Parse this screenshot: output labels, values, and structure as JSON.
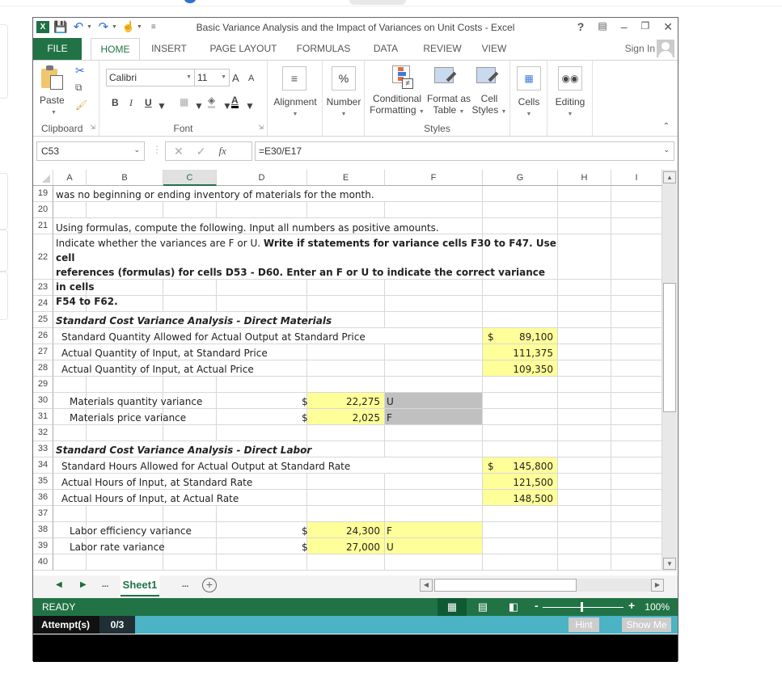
{
  "window": {
    "title": "Basic Variance Analysis and the Impact of Variances on Unit Costs - Excel",
    "controls": {
      "help": "?",
      "ribbon_display": "⊼",
      "minimize": "–",
      "restore": "🗗",
      "close": "✕"
    }
  },
  "quick_access": {
    "icons": [
      "excel-logo-icon",
      "save-icon",
      "undo-icon",
      "redo-icon",
      "touch-mode-icon",
      "customize-qat-icon"
    ]
  },
  "tabs": [
    {
      "label": "FILE",
      "active": false
    },
    {
      "label": "HOME",
      "active": true
    },
    {
      "label": "INSERT",
      "active": false
    },
    {
      "label": "PAGE LAYOUT",
      "active": false
    },
    {
      "label": "FORMULAS",
      "active": false
    },
    {
      "label": "DATA",
      "active": false
    },
    {
      "label": "REVIEW",
      "active": false
    },
    {
      "label": "VIEW",
      "active": false
    }
  ],
  "signin": {
    "label": "Sign In"
  },
  "ribbon": {
    "clipboard": {
      "group_label": "Clipboard",
      "paste_label": "Paste"
    },
    "font": {
      "group_label": "Font",
      "font_name": "Calibri",
      "font_size": "11",
      "bold": "B",
      "italic": "I",
      "underline": "U",
      "grow": "A",
      "shrink": "A",
      "font_color": "A"
    },
    "alignment": {
      "label": "Alignment"
    },
    "number": {
      "label": "Number",
      "symbol": "%"
    },
    "styles": {
      "group_label": "Styles",
      "conditional_line1": "Conditional",
      "conditional_line2": "Formatting",
      "format_table_line1": "Format as",
      "format_table_line2": "Table",
      "cell_styles_line1": "Cell",
      "cell_styles_line2": "Styles"
    },
    "cells": {
      "label": "Cells"
    },
    "editing": {
      "label": "Editing"
    }
  },
  "formula_bar": {
    "name_box": "C53",
    "cancel": "✕",
    "enter": "✓",
    "fx": "fx",
    "formula": "=E30/E17"
  },
  "columns": [
    "A",
    "B",
    "C",
    "D",
    "E",
    "F",
    "G",
    "H",
    "I"
  ],
  "selected_column": "C",
  "rows": {
    "r19": "was no beginning or ending inventory of materials for the month.",
    "r21": "Using formulas, compute the following.  Input all numbers as positive amounts.",
    "r22_plain": "Indicate whether the variances are F or U. ",
    "r22_bold1": "Write if statements for variance cells F30 to F47. Use cell",
    "r22_bold2": "references (formulas) for cells D53 - D60. Enter an  F or U to indicate the correct variance in cells",
    "r22_bold3": "F54 to F62.",
    "r25": "Standard Cost Variance Analysis - Direct Materials",
    "r26": {
      "label": "Standard Quantity Allowed for Actual Output at Standard Price",
      "currency": "$",
      "value": "89,100"
    },
    "r27": {
      "label": "Actual Quantity of Input, at Standard Price",
      "value": "111,375"
    },
    "r28": {
      "label": "Actual Quantity of Input, at Actual Price",
      "value": "109,350"
    },
    "r30": {
      "label": "Materials quantity variance",
      "currency": "$",
      "value": "22,275",
      "flag": "U"
    },
    "r31": {
      "label": "Materials price variance",
      "currency": "$",
      "value": "2,025",
      "flag": "F"
    },
    "r33": "Standard Cost Variance Analysis - Direct Labor",
    "r34": {
      "label": "Standard Hours Allowed for Actual Output at Standard Rate",
      "currency": "$",
      "value": "145,800"
    },
    "r35": {
      "label": "Actual Hours of Input, at Standard Rate",
      "value": "121,500"
    },
    "r36": {
      "label": "Actual Hours of Input, at Actual Rate",
      "value": "148,500"
    },
    "r38": {
      "label": "Labor efficiency variance",
      "currency": "$",
      "value": "24,300",
      "flag": "F"
    },
    "r39": {
      "label": "Labor rate variance",
      "currency": "$",
      "value": "27,000",
      "flag": "U"
    }
  },
  "row_numbers": [
    "19",
    "20",
    "21",
    "22",
    "23",
    "24",
    "25",
    "26",
    "27",
    "28",
    "29",
    "30",
    "31",
    "32",
    "33",
    "34",
    "35",
    "36",
    "37",
    "38",
    "39",
    "40"
  ],
  "sheet_tabs": {
    "prev": "◀",
    "next": "▶",
    "ellipsis_left": "...",
    "active": "Sheet1",
    "ellipsis_right": "...",
    "add": "+"
  },
  "status_bar": {
    "mode": "READY",
    "zoom": "100%",
    "zoom_minus": "-",
    "zoom_plus": "+",
    "zoom_level": 1.0
  },
  "attempts": {
    "label": "Attempt(s)",
    "value": "0/3",
    "hint": "Hint",
    "show_me": "Show Me"
  },
  "colors": {
    "excel_green": "#217346",
    "highlight_yellow": "#ffff99",
    "highlight_gray": "#c0c0c0",
    "attempt_bar": "#4bb3c4"
  }
}
